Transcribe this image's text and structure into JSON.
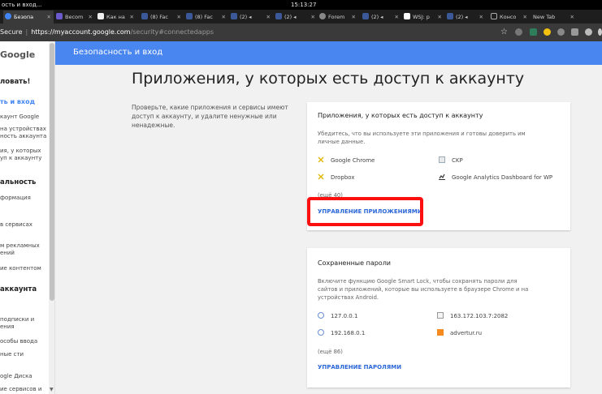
{
  "os": {
    "left_title": "ость и вход...",
    "clock": "15:13:27"
  },
  "tabs": [
    {
      "label": "Безопа",
      "color": "#4285f4",
      "active": true
    },
    {
      "label": "Becom",
      "color": "#6a5acd",
      "active": false
    },
    {
      "label": "Как на",
      "color": "#111111",
      "active": false
    },
    {
      "label": "(8) Fac",
      "color": "#3b5998",
      "active": false
    },
    {
      "label": "(8) Fac",
      "color": "#3b5998",
      "active": false
    },
    {
      "label": "(2) ◂",
      "color": "#3b5998",
      "active": false
    },
    {
      "label": "(2) ◂",
      "color": "#3b5998",
      "active": false
    },
    {
      "label": "Forem",
      "color": "#888888",
      "active": false
    },
    {
      "label": "(2) ◂",
      "color": "#3b5998",
      "active": false
    },
    {
      "label": "WSJ: p",
      "color": "#222222",
      "active": false
    },
    {
      "label": "(2) ◂",
      "color": "#3b5998",
      "active": false
    },
    {
      "label": "Консо",
      "color": "#aaaaaa",
      "active": false
    },
    {
      "label": "New Tab",
      "color": "#1e1e1e",
      "active": false
    }
  ],
  "address": {
    "secure": "Secure",
    "separator": "|",
    "host": "https://myaccount.google.com",
    "path": "/security#connectedapps"
  },
  "sidebar": {
    "logo": "Google",
    "items": [
      {
        "label": "ловать!",
        "style": "head"
      },
      {
        "label": "ть и вход",
        "style": "active"
      },
      {
        "label": "каунт Google",
        "style": "normal"
      },
      {
        "label": "на устройствах ность аккаунта",
        "style": "normal"
      },
      {
        "label": "ия, у которых уп к аккаунту",
        "style": "normal"
      },
      {
        "label": "альность",
        "style": "head"
      },
      {
        "label": "формация",
        "style": "normal"
      },
      {
        "label": "в сервисах",
        "style": "normal"
      },
      {
        "label": "м рекламных ений",
        "style": "normal"
      },
      {
        "label": "ие контентом",
        "style": "normal"
      },
      {
        "label": "аккаунта",
        "style": "head"
      },
      {
        "label": "подписки и ения",
        "style": "normal"
      },
      {
        "label": "особы ввода",
        "style": "normal"
      },
      {
        "label": "ные сти",
        "style": "normal"
      },
      {
        "label": "ogle Диска",
        "style": "normal"
      },
      {
        "label": "ие сервисов и",
        "style": "normal"
      }
    ]
  },
  "header": {
    "title": "Безопасность и вход"
  },
  "main": {
    "title": "Приложения, у которых есть доступ к аккаунту",
    "description": "Проверьте, какие приложения и сервисы имеют доступ к аккаунту, и удалите ненужные или ненадежные."
  },
  "apps_card": {
    "title": "Приложения, у которых есть доступ к аккаунту",
    "text": "Убедитесь, что вы используете эти приложения и готовы доверить им личные данные.",
    "items": [
      {
        "label": "Google Chrome",
        "icon": "chrome-app-icon"
      },
      {
        "label": "CKP",
        "icon": "ckp-app-icon"
      },
      {
        "label": "Dropbox",
        "icon": "dropbox-app-icon"
      },
      {
        "label": "Google Analytics Dashboard for WP",
        "icon": "analytics-app-icon"
      }
    ],
    "more": "(ещё 40)",
    "manage": "УПРАВЛЕНИЕ ПРИЛОЖЕНИЯМИ"
  },
  "passwords_card": {
    "title": "Сохраненные пароли",
    "text": "Включите функцию Google Smart Lock, чтобы сохранять пароли для сайтов и приложений, которые вы используете в браузере Chrome и на устройствах Android.",
    "items": [
      {
        "label": "127.0.0.1",
        "icon": "globe-icon"
      },
      {
        "label": "163.172.103.7:2082",
        "icon": "broken-image-icon"
      },
      {
        "label": "192.168.0.1",
        "icon": "globe-icon"
      },
      {
        "label": "advertur.ru",
        "icon": "advertur-icon"
      }
    ],
    "more": "(ещё 86)",
    "manage": "УПРАВЛЕНИЕ ПАРОЛЯМИ"
  },
  "colors": {
    "header": "#4a86f0",
    "link": "#2a66d8",
    "highlight": "#ff1010"
  }
}
